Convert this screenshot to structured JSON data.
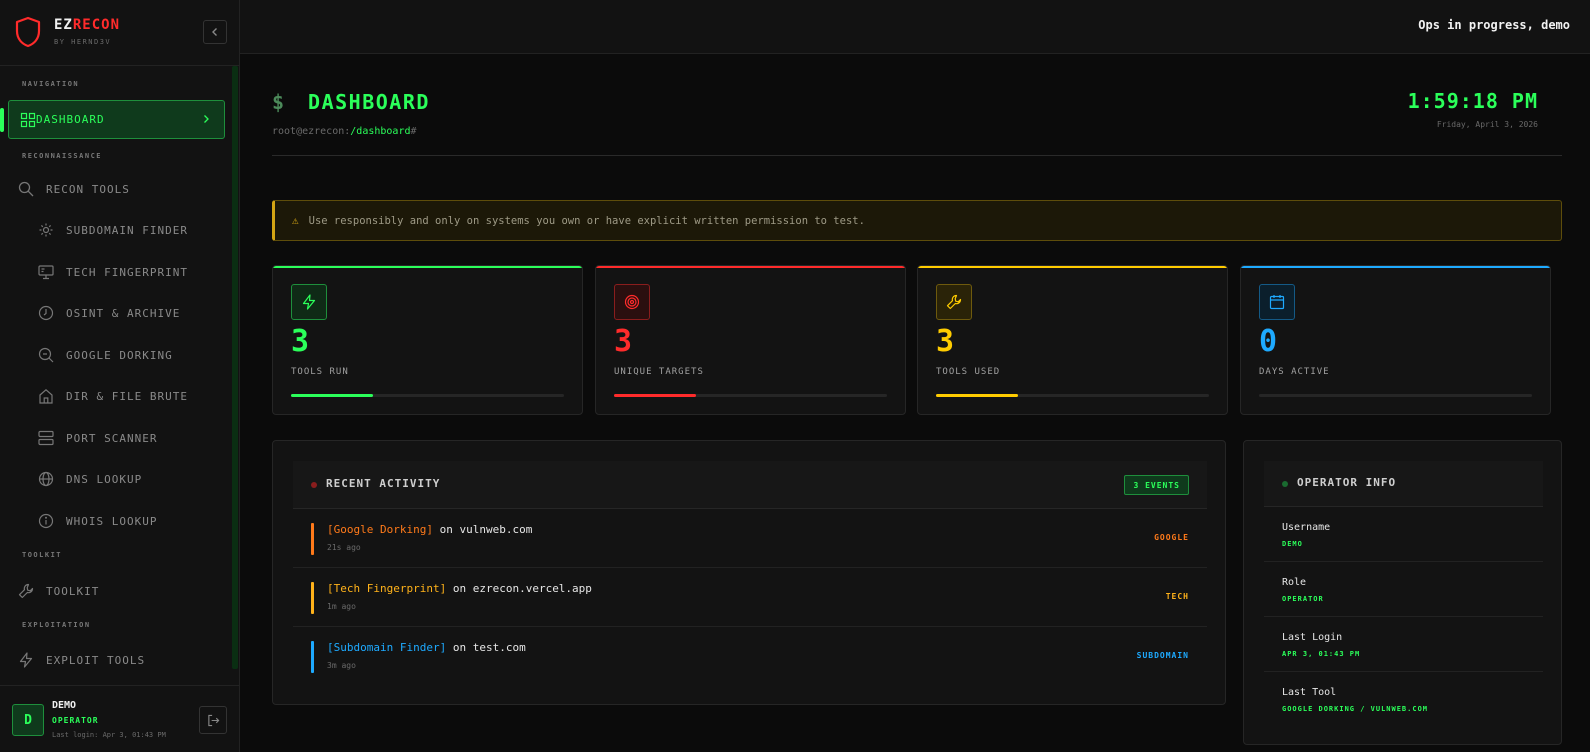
{
  "brand": {
    "name_part1": "EZ",
    "name_part2": "RECON",
    "subtitle": "BY HERND3V"
  },
  "sidebar": {
    "sections": {
      "navigation": "NAVIGATION",
      "recon": "RECONNAISSANCE",
      "toolkit": "TOOLKIT",
      "exploitation": "EXPLOITATION"
    },
    "items": {
      "dashboard": "DASHBOARD",
      "recon_tools": "RECON TOOLS",
      "subdomain_finder": "SUBDOMAIN FINDER",
      "tech_fingerprint": "TECH FINGERPRINT",
      "osint_archive": "OSINT & ARCHIVE",
      "google_dorking": "GOOGLE DORKING",
      "dir_file_brute": "DIR & FILE BRUTE",
      "port_scanner": "PORT SCANNER",
      "dns_lookup": "DNS LOOKUP",
      "whois_lookup": "WHOIS LOOKUP",
      "toolkit": "TOOLKIT",
      "exploit_tools": "EXPLOIT TOOLS"
    },
    "active_item": "dashboard",
    "user": {
      "initial": "D",
      "name": "DEMO",
      "role": "OPERATOR",
      "last_login": "Last login: Apr 3, 01:43 PM"
    }
  },
  "topbar": {
    "status": "Ops in progress, demo"
  },
  "header": {
    "prompt_symbol": "$",
    "title": "DASHBOARD",
    "crumb_prefix": "root@ezrecon:",
    "crumb_path": "/dashboard",
    "crumb_suffix": "#",
    "time": "1:59:18 PM",
    "date": "Friday, April 3, 2026"
  },
  "warning": {
    "icon": "⚠",
    "text": "Use responsibly and only on systems you own or have explicit written permission to test."
  },
  "stats": [
    {
      "value": "3",
      "label": "TOOLS RUN",
      "icon": "bolt-icon",
      "color": "#2bff5a",
      "progress": 0.3
    },
    {
      "value": "3",
      "label": "UNIQUE TARGETS",
      "icon": "target-icon",
      "color": "#ff2b2b",
      "progress": 0.3
    },
    {
      "value": "3",
      "label": "TOOLS USED",
      "icon": "wrench-icon",
      "color": "#ffcc00",
      "progress": 0.3
    },
    {
      "value": "0",
      "label": "DAYS ACTIVE",
      "icon": "calendar-icon",
      "color": "#1eaaff",
      "progress": 0
    }
  ],
  "activity": {
    "title": "RECENT ACTIVITY",
    "badge": "3 EVENTS",
    "events": [
      {
        "tool": "[Google Dorking]",
        "on": " on ",
        "target": "vulnweb.com",
        "ago": "21s ago",
        "tag": "GOOGLE",
        "color": "#ff7a1a"
      },
      {
        "tool": "[Tech Fingerprint]",
        "on": " on ",
        "target": "ezrecon.vercel.app",
        "ago": "1m ago",
        "tag": "TECH",
        "color": "#ffb21a"
      },
      {
        "tool": "[Subdomain Finder]",
        "on": " on ",
        "target": "test.com",
        "ago": "3m ago",
        "tag": "SUBDOMAIN",
        "color": "#1eaaff"
      }
    ]
  },
  "operator": {
    "title": "OPERATOR INFO",
    "rows": [
      {
        "key": "Username",
        "value": "DEMO"
      },
      {
        "key": "Role",
        "value": "OPERATOR"
      },
      {
        "key": "Last Login",
        "value": "APR 3, 01:43 PM"
      },
      {
        "key": "Last Tool",
        "value": "GOOGLE DORKING / VULNWEB.COM"
      }
    ]
  }
}
